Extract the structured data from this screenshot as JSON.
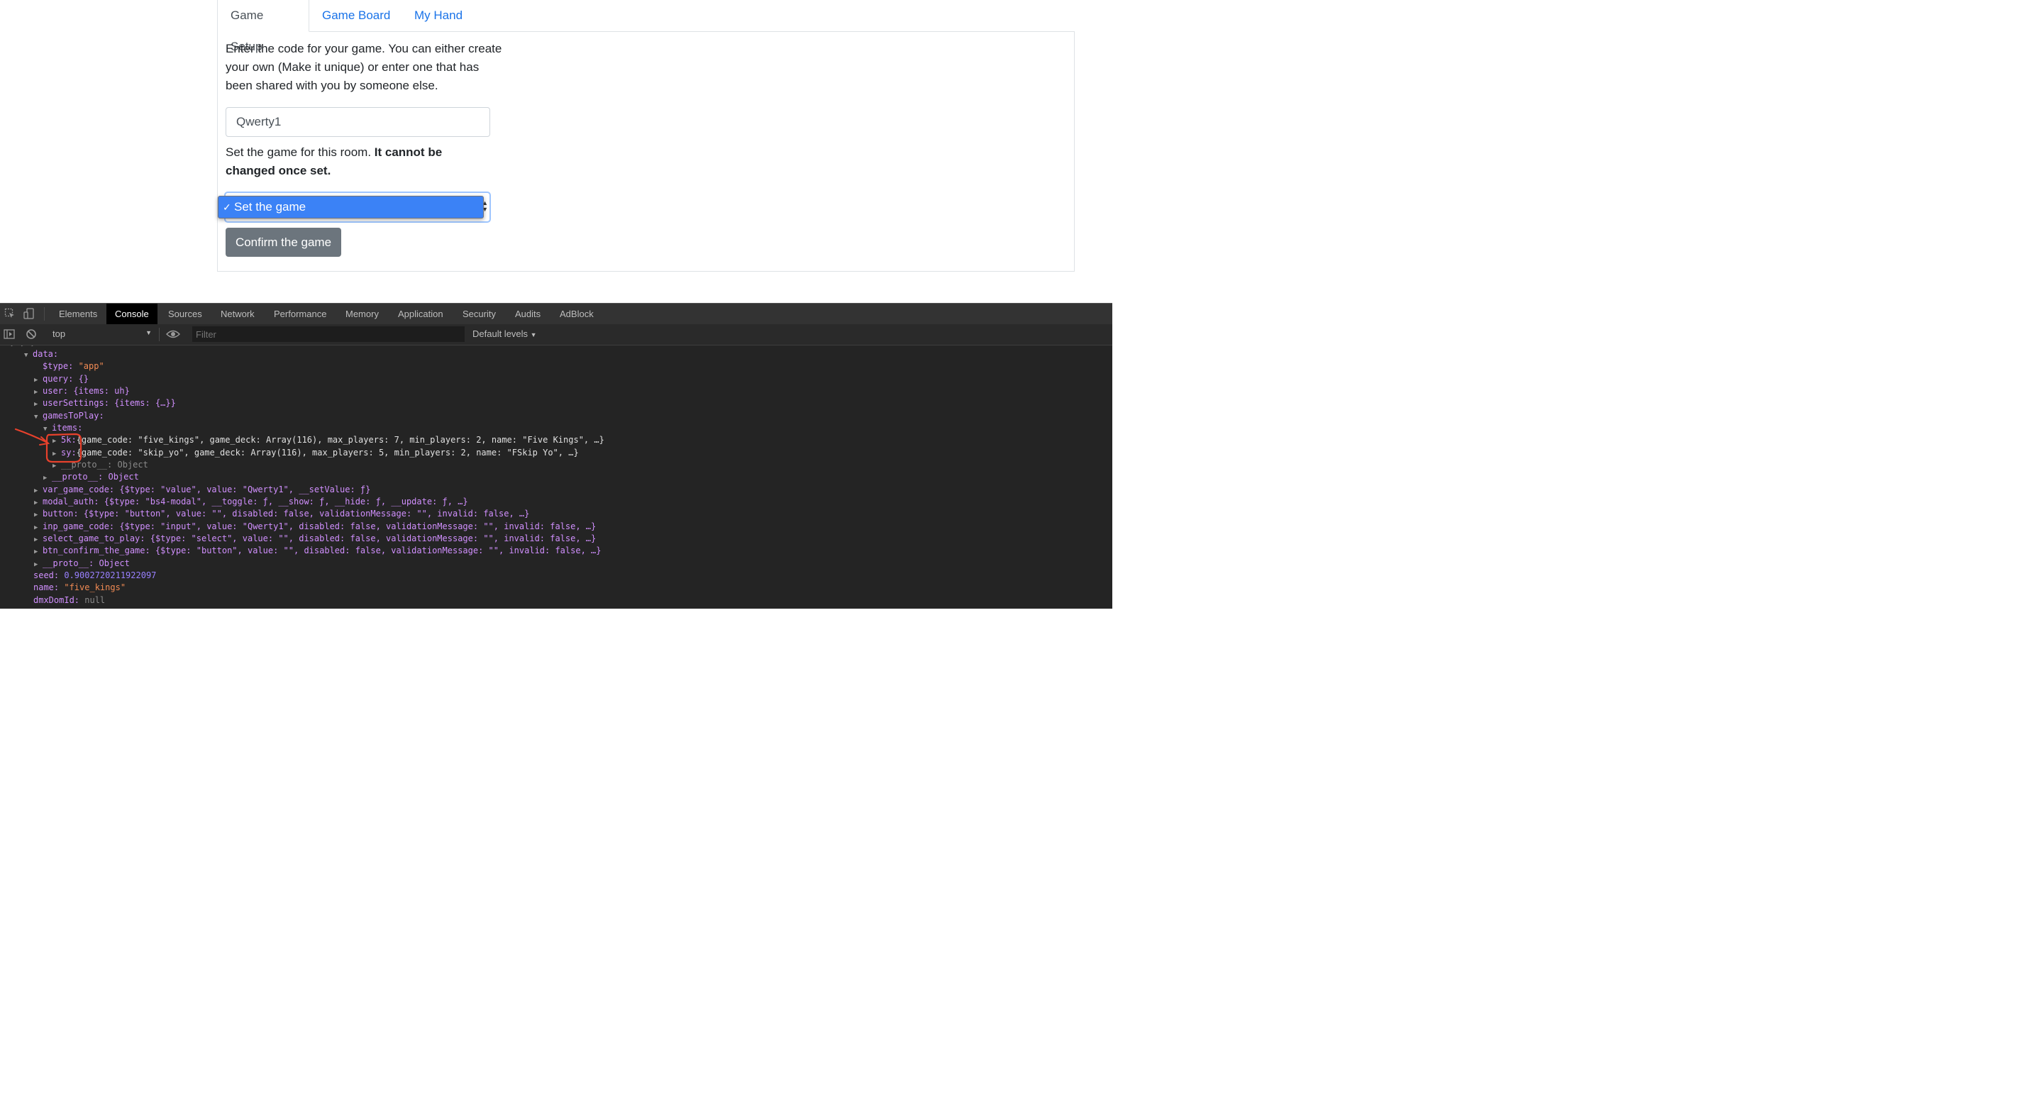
{
  "tabs": [
    {
      "label": "Game Setup"
    },
    {
      "label": "Game Board"
    },
    {
      "label": "My Hand"
    }
  ],
  "setup": {
    "intro": "Enter the code for your game. You can either create your own (Make it unique) or enter one that has been shared with you by someone else.",
    "code_value": "Qwerty1",
    "set_text": "Set the game for this room. ",
    "set_text_bold": "It cannot be changed once set.",
    "select_option": "Set the game",
    "confirm_label": "Confirm the game"
  },
  "devtools": {
    "tabs": [
      "Elements",
      "Console",
      "Sources",
      "Network",
      "Performance",
      "Memory",
      "Application",
      "Security",
      "Audits",
      "AdBlock"
    ],
    "active_tab": "Console",
    "context": "top",
    "filter_placeholder": "Filter",
    "levels": "Default levels",
    "lines": {
      "data": "data:",
      "type": "$type: ",
      "type_val": "\"app\"",
      "query": "query: {}",
      "user": "user: {items: uh}",
      "userSettings": "userSettings: {items: {…}}",
      "gamesToPlay": "gamesToPlay:",
      "items": "items:",
      "fivek_key": "5k:",
      "fivek_rest": "{game_code: \"five_kings\", game_deck: Array(116), max_players: 7, min_players: 2, name: \"Five Kings\", …}",
      "sy_key": "sy:",
      "sy_rest": "{game_code: \"skip_yo\", game_deck: Array(116), max_players: 5, min_players: 2, name: \"FSkip Yo\", …}",
      "proto": "__proto__: Object",
      "var_game_code": "var_game_code: {$type: \"value\", value: \"Qwerty1\", __setValue: ƒ}",
      "modal_auth": "modal_auth: {$type: \"bs4-modal\", __toggle: ƒ, __show: ƒ, __hide: ƒ, __update: ƒ, …}",
      "button": "button: {$type: \"button\", value: \"\", disabled: false, validationMessage: \"\", invalid: false, …}",
      "inp_game_code": "inp_game_code: {$type: \"input\", value: \"Qwerty1\", disabled: false, validationMessage: \"\", invalid: false, …}",
      "select_game_to_play": "select_game_to_play: {$type: \"select\", value: \"\", disabled: false, validationMessage: \"\", invalid: false, …}",
      "btn_confirm_the_game": "btn_confirm_the_game: {$type: \"button\", value: \"\", disabled: false, validationMessage: \"\", invalid: false, …}",
      "seed": "seed: ",
      "seed_val": "0.9002720211922097",
      "name": "name: ",
      "name_val": "\"five_kings\"",
      "dmxDomId": "dmxDomId: ",
      "dmxDomId_val": "null"
    }
  },
  "colors": {
    "link": "#1a73e8",
    "annotation": "#e8412c",
    "button_gray": "#6c757d",
    "select_highlight": "#3b82f6"
  }
}
